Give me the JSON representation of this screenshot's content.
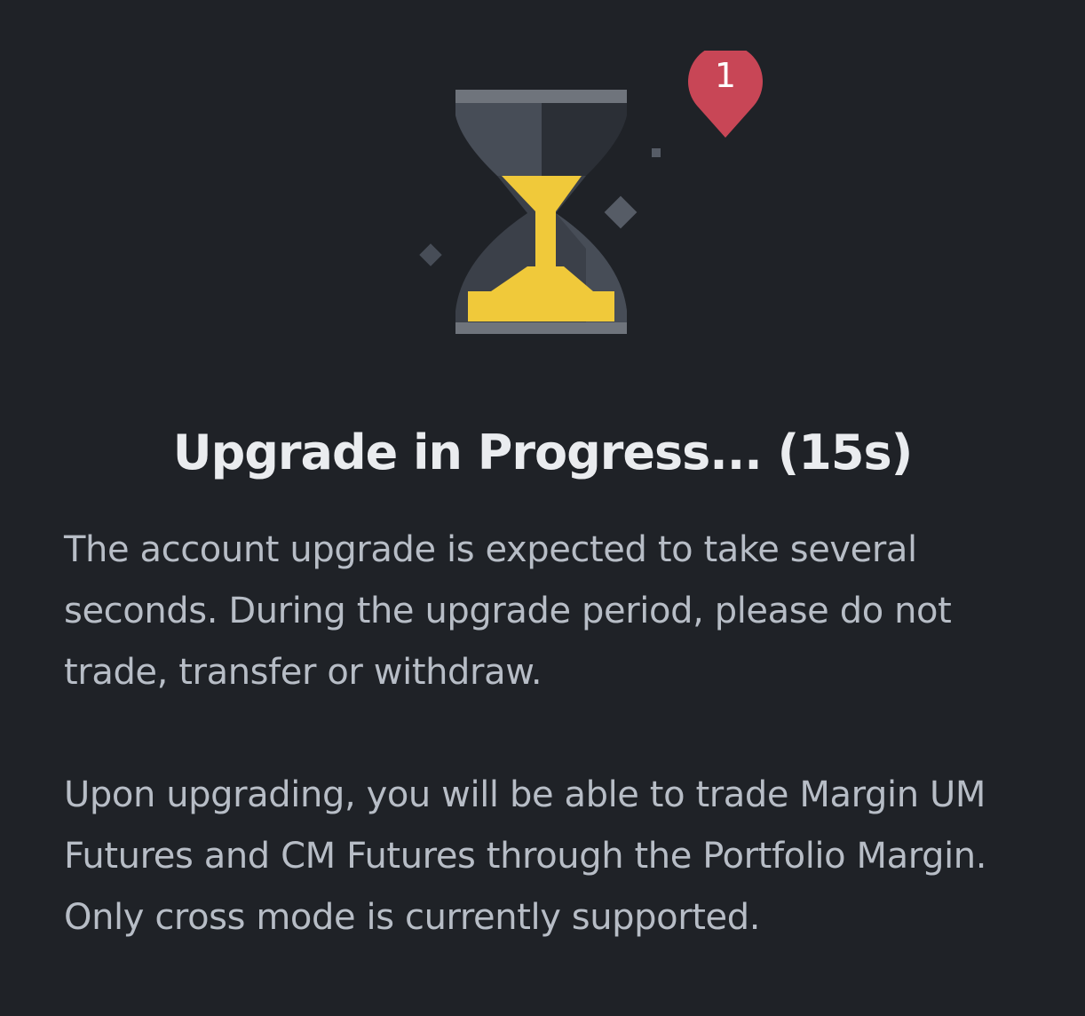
{
  "dialog": {
    "title": "Upgrade in Progress... (15s)",
    "paragraphs": [
      "The account upgrade is expected to take several seconds. During the upgrade period, please do not trade, transfer or withdraw.",
      "Upon upgrading, you will be able to trade Margin UM Futures and CM Futures through the Portfolio Margin. Only cross mode is currently supported."
    ]
  },
  "marker": {
    "label": "1",
    "color": "#c84656"
  },
  "illustration": {
    "icon": "hourglass-icon",
    "sand_color": "#f0c93a"
  },
  "colors": {
    "background": "#1f2227",
    "title": "#eaecef",
    "body_text": "#b7bdc6"
  }
}
